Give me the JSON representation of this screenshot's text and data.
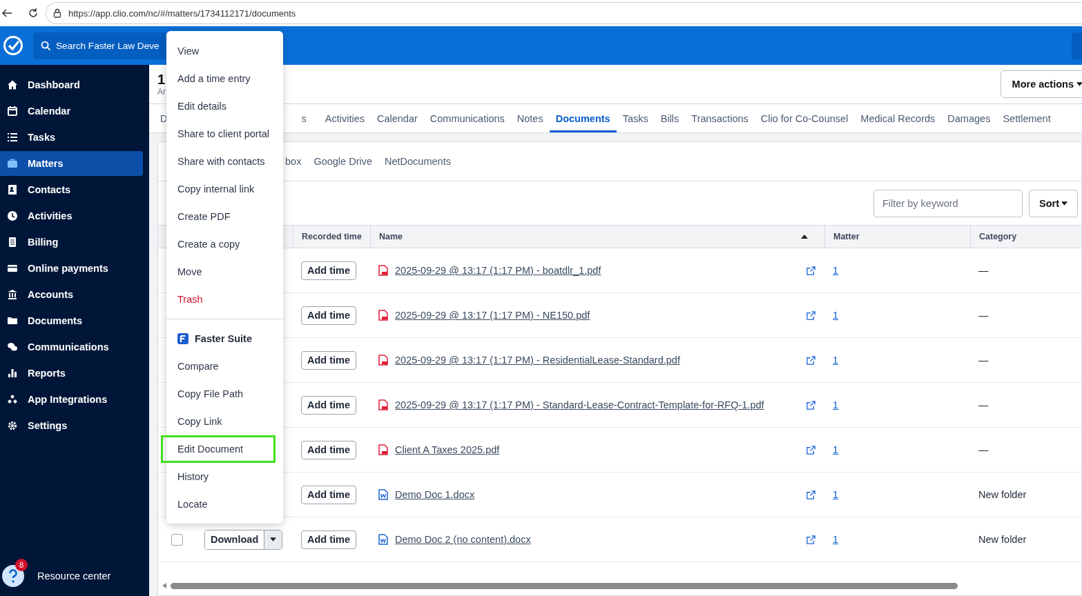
{
  "browser": {
    "url": "https://app.clio.com/nc/#/matters/1734112171/documents"
  },
  "topbar": {
    "search_placeholder": "Search Faster Law Deve"
  },
  "sidebar": {
    "items": [
      {
        "label": "Dashboard",
        "selected": false
      },
      {
        "label": "Calendar",
        "selected": false
      },
      {
        "label": "Tasks",
        "selected": false
      },
      {
        "label": "Matters",
        "selected": true
      },
      {
        "label": "Contacts",
        "selected": false
      },
      {
        "label": "Activities",
        "selected": false
      },
      {
        "label": "Billing",
        "selected": false
      },
      {
        "label": "Online payments",
        "selected": false
      },
      {
        "label": "Accounts",
        "selected": false
      },
      {
        "label": "Documents",
        "selected": false
      },
      {
        "label": "Communications",
        "selected": false
      },
      {
        "label": "Reports",
        "selected": false
      },
      {
        "label": "App Integrations",
        "selected": false
      },
      {
        "label": "Settings",
        "selected": false
      }
    ],
    "resource_center": {
      "label": "Resource center",
      "badge": "8"
    }
  },
  "header": {
    "title": "1",
    "subtitle": "Ar",
    "more_actions": "More actions"
  },
  "tabs": [
    {
      "label": "D",
      "selected": false
    },
    {
      "label": "s",
      "selected": false
    },
    {
      "label": "Activities",
      "selected": false
    },
    {
      "label": "Calendar",
      "selected": false
    },
    {
      "label": "Communications",
      "selected": false
    },
    {
      "label": "Notes",
      "selected": false
    },
    {
      "label": "Documents",
      "selected": true
    },
    {
      "label": "Tasks",
      "selected": false
    },
    {
      "label": "Bills",
      "selected": false
    },
    {
      "label": "Transactions",
      "selected": false
    },
    {
      "label": "Clio for Co-Counsel",
      "selected": false
    },
    {
      "label": "Medical Records",
      "selected": false
    },
    {
      "label": "Damages",
      "selected": false
    },
    {
      "label": "Settlement",
      "selected": false
    }
  ],
  "sources": [
    {
      "label": "box"
    },
    {
      "label": "Google Drive"
    },
    {
      "label": "NetDocuments"
    }
  ],
  "toolbar": {
    "filter_placeholder": "Filter by keyword",
    "sort": "Sort"
  },
  "table": {
    "columns": [
      {
        "label": "Recorded time",
        "sorted": false
      },
      {
        "label": "Name",
        "sorted": true
      },
      {
        "label": "Matter",
        "sorted": false
      },
      {
        "label": "Category",
        "sorted": false
      }
    ],
    "rows": [
      {
        "add_time": "Add time",
        "kind": "pdf",
        "name": "2025-09-29 @ 13:17 (1:17 PM) - boatdlr_1.pdf",
        "matter": "1",
        "category": "—"
      },
      {
        "add_time": "Add time",
        "kind": "pdf",
        "name": "2025-09-29 @ 13:17 (1:17 PM) - NE150.pdf",
        "matter": "1",
        "category": "—"
      },
      {
        "add_time": "Add time",
        "kind": "pdf",
        "name": "2025-09-29 @ 13:17 (1:17 PM) - ResidentialLease-Standard.pdf",
        "matter": "1",
        "category": "—"
      },
      {
        "add_time": "Add time",
        "kind": "pdf",
        "name": "2025-09-29 @ 13:17 (1:17 PM) - Standard-Lease-Contract-Template-for-RFQ-1.pdf",
        "matter": "1",
        "category": "—"
      },
      {
        "add_time": "Add time",
        "kind": "pdf",
        "name": "Client A Taxes 2025.pdf",
        "matter": "1",
        "category": "—"
      },
      {
        "add_time": "Add time",
        "kind": "docx",
        "name": "Demo Doc 1.docx",
        "matter": "1",
        "category": "New folder"
      },
      {
        "checked": false,
        "download": "Download",
        "add_time": "Add time",
        "kind": "docx",
        "name": "Demo Doc 2 (no content).docx",
        "matter": "1",
        "category": "New folder"
      }
    ]
  },
  "menu": {
    "items": [
      {
        "kind": "action",
        "label": "View",
        "highlighted": false
      },
      {
        "kind": "action",
        "label": "Add a time entry",
        "highlighted": false
      },
      {
        "kind": "action",
        "label": "Edit details",
        "highlighted": false
      },
      {
        "kind": "action",
        "label": "Share to client portal",
        "highlighted": false
      },
      {
        "kind": "action",
        "label": "Share with contacts",
        "highlighted": false
      },
      {
        "kind": "action",
        "label": "Copy internal link",
        "highlighted": false
      },
      {
        "kind": "action",
        "label": "Create PDF",
        "highlighted": false
      },
      {
        "kind": "action",
        "label": "Create a copy",
        "highlighted": false
      },
      {
        "kind": "action",
        "label": "Move",
        "highlighted": false
      },
      {
        "kind": "danger",
        "label": "Trash",
        "highlighted": false
      },
      {
        "kind": "heading",
        "label": "Faster Suite"
      },
      {
        "kind": "action",
        "label": "Compare",
        "highlighted": false
      },
      {
        "kind": "action",
        "label": "Copy File Path",
        "highlighted": false
      },
      {
        "kind": "action",
        "label": "Copy Link",
        "highlighted": false
      },
      {
        "kind": "action",
        "label": "Edit Document",
        "highlighted": true
      },
      {
        "kind": "action",
        "label": "History",
        "highlighted": false
      },
      {
        "kind": "action",
        "label": "Locate",
        "highlighted": false
      }
    ]
  }
}
